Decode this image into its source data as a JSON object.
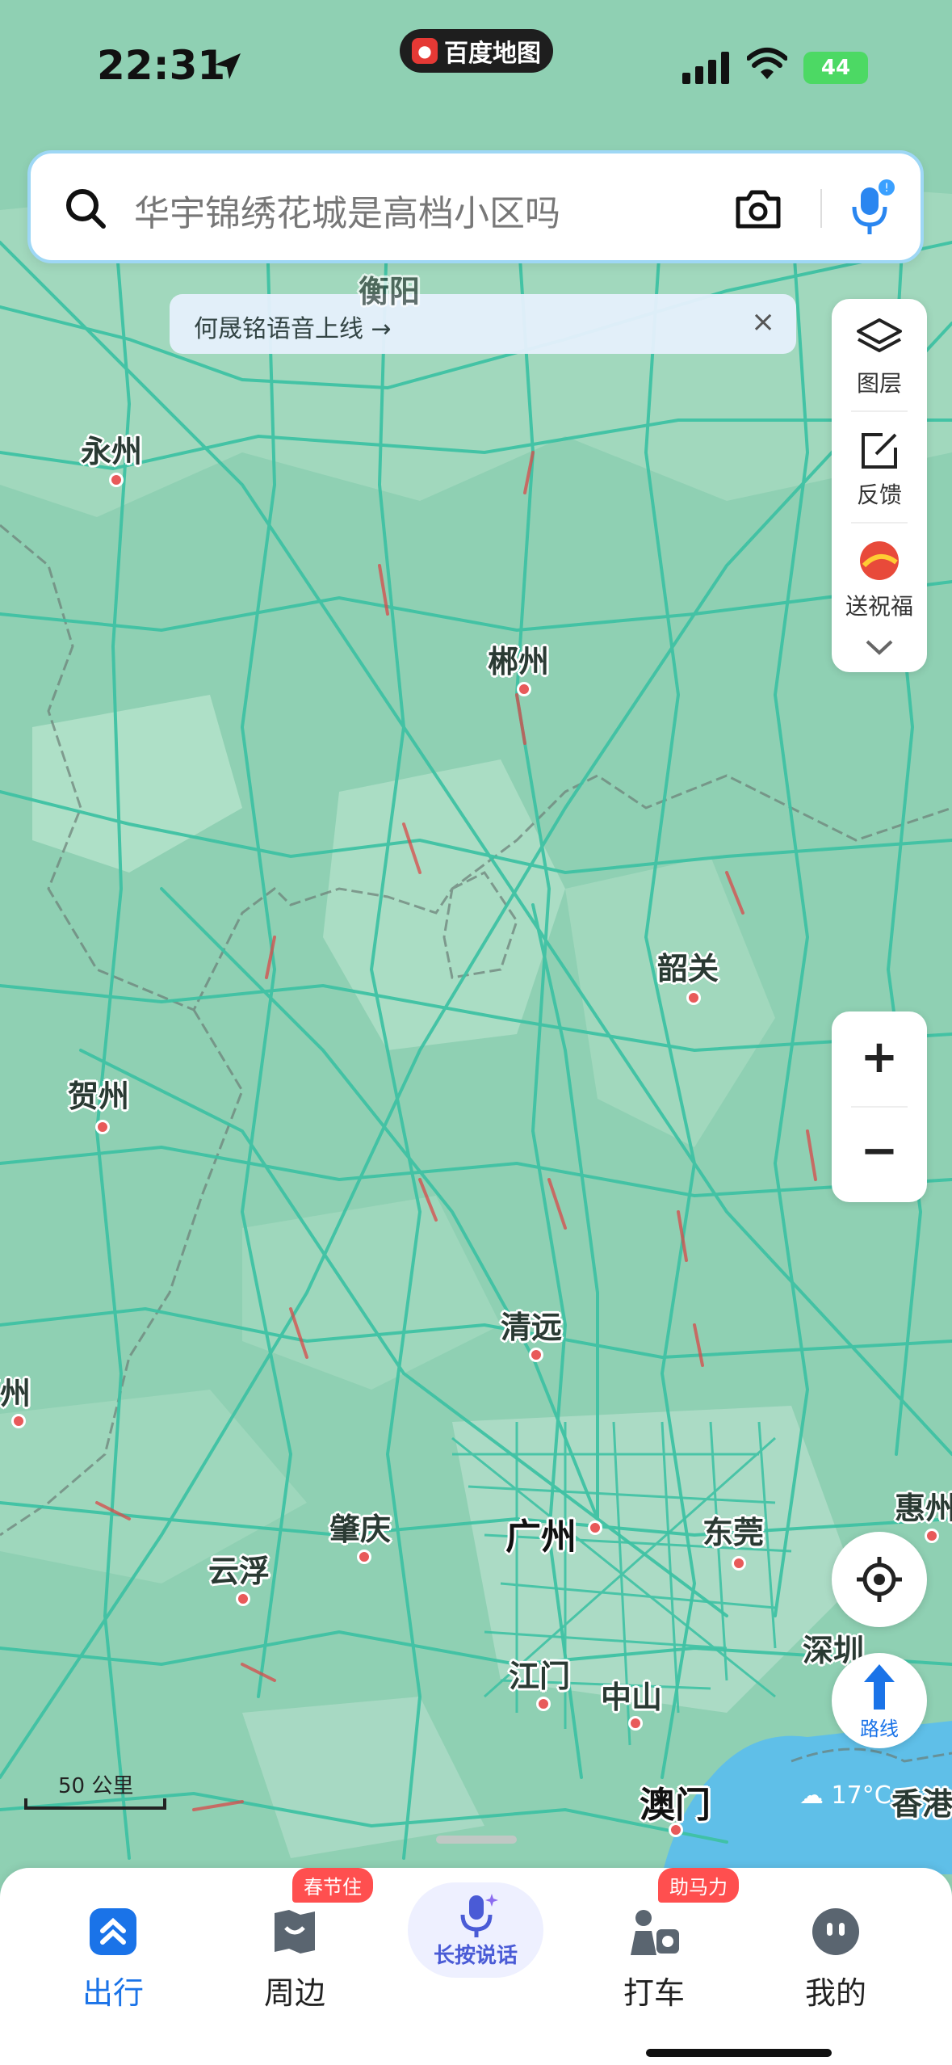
{
  "status_bar": {
    "time": "22:31",
    "app_name": "百度地图",
    "battery": "44"
  },
  "search": {
    "placeholder": "华宇锦绣花城是高档小区吗"
  },
  "banner": {
    "text": "何晟铭语音上线 →",
    "close": "×"
  },
  "right_panel": {
    "layers": "图层",
    "feedback": "反馈",
    "blessing": "送祝福"
  },
  "zoom": {
    "in": "+",
    "out": "−"
  },
  "route_button": {
    "label": "路线"
  },
  "scale": {
    "label": "50 公里"
  },
  "weather": {
    "temp": "17°C"
  },
  "cities": {
    "hengyang": "衡阳",
    "yongzhou": "永州",
    "chenzhou": "郴州",
    "shaoguan": "韶关",
    "hezhou": "贺州",
    "wuzhou": "梧州",
    "qingyuan": "清远",
    "zhaoqing": "肇庆",
    "guangzhou": "广州",
    "dongguan": "东莞",
    "huizhou": "惠州",
    "yunfu": "云浮",
    "jiangmen": "江门",
    "zhongshan": "中山",
    "shenzhen": "深圳",
    "macau": "澳门",
    "hongkong": "香港"
  },
  "tabs": {
    "travel": "出行",
    "nearby": "周边",
    "nearby_badge": "春节住",
    "voice": "长按说话",
    "taxi": "打车",
    "taxi_badge": "助马力",
    "mine": "我的"
  },
  "colors": {
    "map_bg": "#8fd0b3",
    "road": "#3fc2a4",
    "accent": "#1a73e8",
    "badge": "#ff4f4f"
  }
}
